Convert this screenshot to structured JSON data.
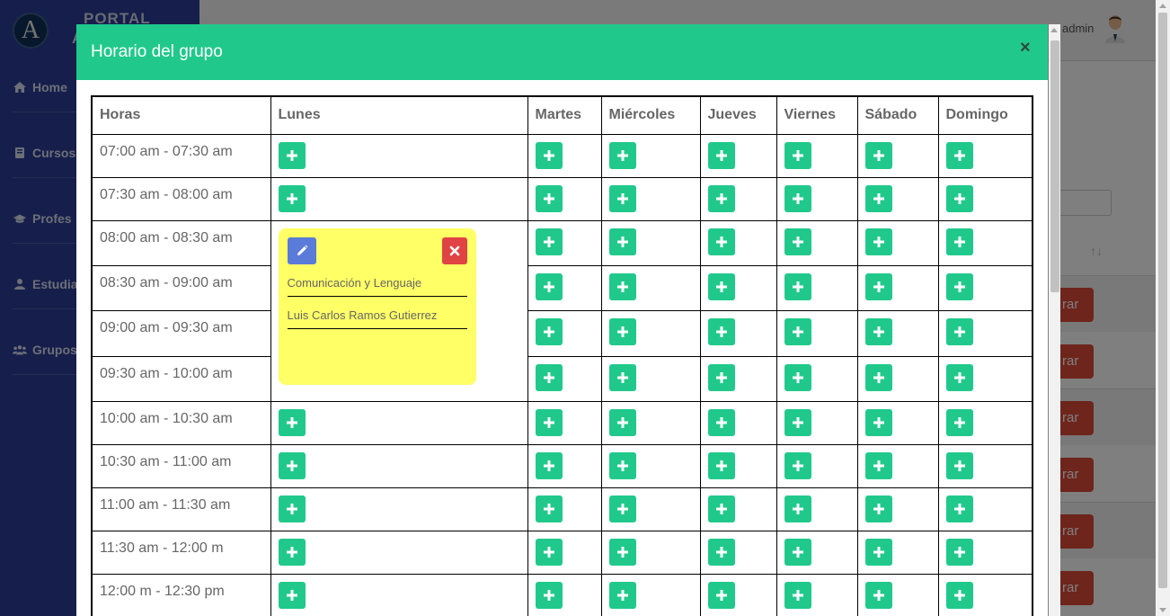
{
  "sidebar": {
    "logo_letter": "A",
    "brand_title": "PORTAL",
    "brand_sub": "A",
    "items": [
      {
        "label": "Home",
        "icon": "home-icon"
      },
      {
        "label": "Cursos",
        "icon": "book-icon"
      },
      {
        "label": "Profes",
        "icon": "graduation-cap-icon"
      },
      {
        "label": "Estudia",
        "icon": "user-icon"
      },
      {
        "label": "Grupos",
        "icon": "users-icon"
      }
    ]
  },
  "topbar": {
    "user_name": "admin"
  },
  "background": {
    "sort_glyph": "↑↓",
    "delete_label": "rar"
  },
  "modal": {
    "title": "Horario del grupo",
    "close_glyph": "×",
    "headers": [
      "Horas",
      "Lunes",
      "Martes",
      "Miércoles",
      "Jueves",
      "Viernes",
      "Sábado",
      "Domingo"
    ],
    "hours": [
      "07:00 am - 07:30 am",
      "07:30 am - 08:00 am",
      "08:00 am - 08:30 am",
      "08:30 am - 09:00 am",
      "09:00 am - 09:30 am",
      "09:30 am - 10:00 am",
      "10:00 am - 10:30 am",
      "10:30 am - 11:00 am",
      "11:00 am - 11:30 am",
      "11:30 am - 12:00 m",
      "12:00 m - 12:30 pm"
    ],
    "event": {
      "course": "Comunicación y Lenguaje",
      "teacher": "Luis Carlos Ramos Gutierrez",
      "color": "#ffff66"
    }
  },
  "colors": {
    "accent": "#20c98b",
    "sidebar": "#2c3e97",
    "edit": "#5b7bd8",
    "delete": "#e04343"
  }
}
